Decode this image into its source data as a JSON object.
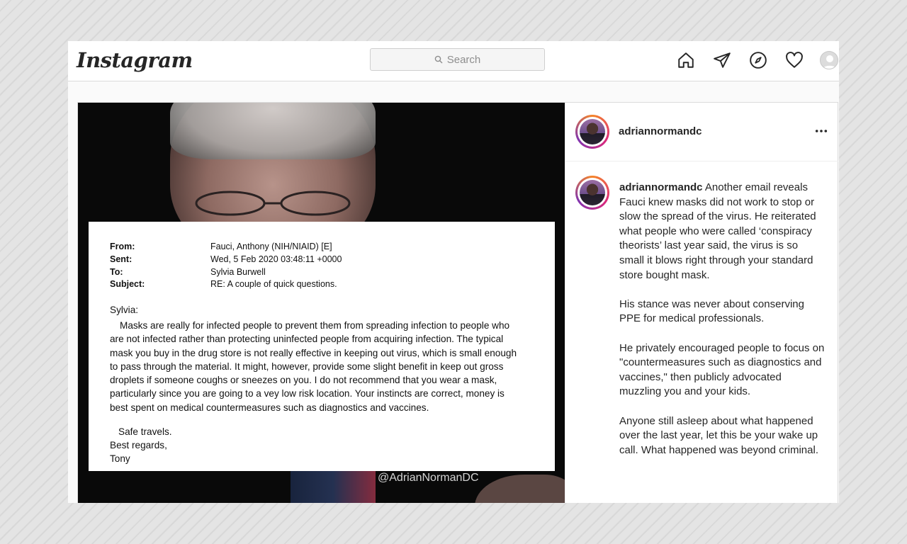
{
  "app": {
    "logo": "Instagram"
  },
  "search": {
    "placeholder": "Search"
  },
  "nav": {
    "icons": [
      "home-icon",
      "direct-icon",
      "explore-icon",
      "activity-heart-icon",
      "profile-avatar"
    ]
  },
  "post": {
    "username": "adriannormandc",
    "more_icon": "more-dots-icon",
    "media": {
      "email": {
        "from_label": "From:",
        "from_value": "Fauci, Anthony (NIH/NIAID) [E]",
        "sent_label": "Sent:",
        "sent_value": "Wed, 5 Feb 2020 03:48:11 +0000",
        "to_label": "To:",
        "to_value": "Sylvia Burwell",
        "subject_label": "Subject:",
        "subject_value": "RE: A couple of quick questions.",
        "salutation": "Sylvia:",
        "body_lines": [
          "Masks are really for infected people to prevent them from spreading infection to people who",
          "are not infected rather than protecting uninfected people from acquiring infection.   The typical",
          "mask you buy in the drug store is not really effective in keeping out virus, which is small enough",
          "to pass through the material.   It might, however, provide some slight benefit in keep out gross",
          "droplets if someone coughs or sneezes on you.  I do not recommend that you wear a mask,",
          "particularly since you are going to a vey low risk location.   Your instincts are correct, money is",
          "best spent on medical countermeasures such as diagnostics and vaccines."
        ],
        "closing_1": "Safe travels.",
        "closing_2": "Best regards,",
        "closing_3": "Tony"
      },
      "watermark": "@AdrianNormanDC"
    },
    "caption": {
      "author": "adriannormandc",
      "p1": "Another email reveals Fauci knew masks did not work to stop or slow the spread of the virus. He reiterated what people who were called ‘conspiracy theorists’ last year said, the virus is so small it blows right through your standard store bought mask.",
      "p2": "His stance was never about conserving PPE for medical professionals.",
      "p3": "He privately encouraged people to focus on \"countermeasures such as diagnostics and vaccines,\" then publicly advocated muzzling you and your kids.",
      "p4": "Anyone still asleep about what happened over the last year, let this be your wake up call. What happened was beyond criminal."
    }
  }
}
